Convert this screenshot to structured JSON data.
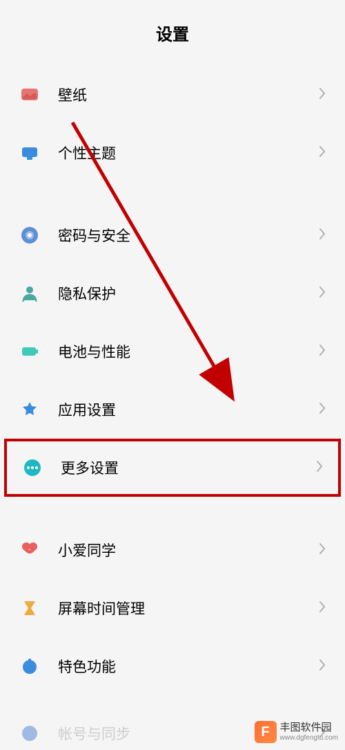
{
  "header": {
    "title": "设置"
  },
  "items": [
    {
      "id": "wallpaper",
      "label": "壁纸",
      "icon": "wallpaper-icon",
      "icon_color": "#e87373"
    },
    {
      "id": "theme",
      "label": "个性主题",
      "icon": "theme-icon",
      "icon_color": "#3b8cde"
    },
    {
      "id": "security",
      "label": "密码与安全",
      "icon": "security-icon",
      "icon_color": "#5d8fd6"
    },
    {
      "id": "privacy",
      "label": "隐私保护",
      "icon": "privacy-icon",
      "icon_color": "#4aa89f"
    },
    {
      "id": "battery",
      "label": "电池与性能",
      "icon": "battery-icon",
      "icon_color": "#3ec9b8"
    },
    {
      "id": "apps",
      "label": "应用设置",
      "icon": "apps-icon",
      "icon_color": "#3b8cde"
    },
    {
      "id": "more",
      "label": "更多设置",
      "icon": "more-icon",
      "icon_color": "#1eb8c4",
      "highlighted": true
    },
    {
      "id": "xiaoai",
      "label": "小爱同学",
      "icon": "xiaoai-icon",
      "icon_color": "#e8605e"
    },
    {
      "id": "screentime",
      "label": "屏幕时间管理",
      "icon": "screentime-icon",
      "icon_color": "#f0a93c"
    },
    {
      "id": "features",
      "label": "特色功能",
      "icon": "features-icon",
      "icon_color": "#3b8cde"
    },
    {
      "id": "cutoff",
      "label": "帐号与同步",
      "icon": "cutoff-icon",
      "icon_color": "#5d8fd6"
    }
  ],
  "annotation": {
    "arrow_color": "#c20000"
  },
  "watermark": {
    "logo_text": "F",
    "name": "丰图软件园",
    "url": "www.dgfengtu.com"
  }
}
